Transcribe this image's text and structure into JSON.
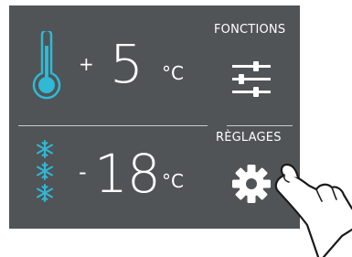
{
  "fridge": {
    "sign": "+",
    "value": "5",
    "unit": "°C",
    "icon": "thermometer-icon"
  },
  "freezer": {
    "sign": "-",
    "value": "18",
    "unit": "°C",
    "icon": "snowflake-icon"
  },
  "functions": {
    "label": "FONCTIONS",
    "icon": "sliders-icon"
  },
  "settings": {
    "label": "RÈGLAGES",
    "icon": "gear-icon"
  },
  "colors": {
    "panel": "#505456",
    "accent": "#2fb9d6",
    "text": "#ffffff"
  }
}
